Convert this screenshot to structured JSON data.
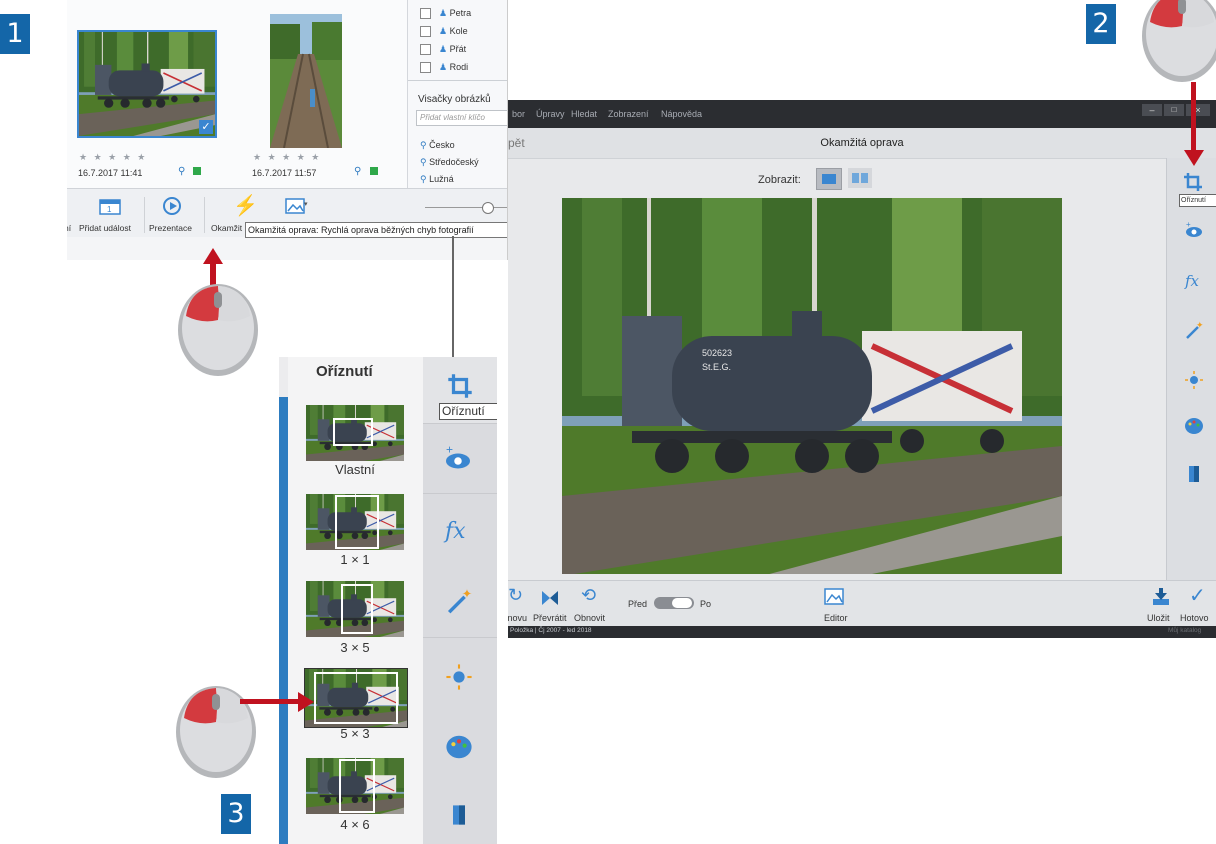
{
  "steps": {
    "one": "1",
    "two": "2",
    "three": "3"
  },
  "panel1": {
    "photos": [
      {
        "date": "16.7.2017 11:41",
        "stars": "★ ★ ★ ★ ★"
      },
      {
        "date": "16.7.2017 11:57",
        "stars": "★ ★ ★ ★ ★"
      }
    ],
    "people": [
      "Petra",
      "Kole",
      "Přát",
      "Rodi"
    ],
    "tags_header": "Visačky obrázků",
    "tags_placeholder": "Přidat vlastní klíčo",
    "places": [
      "Česko",
      "Středočeský",
      "Lužná"
    ],
    "toolbar": {
      "add_event": "Přidat událost",
      "add_event_prefix": "ní",
      "slideshow": "Prezentace",
      "quick_fix": "Okamžit"
    },
    "tooltip": "Okamžitá oprava: Rychlá oprava běžných chyb fotografií"
  },
  "panel2": {
    "menu": [
      "bor",
      "Úpravy",
      "Hledat",
      "Zobrazení",
      "Nápověda"
    ],
    "back": "pět",
    "title": "Okamžitá oprava",
    "view_label": "Zobrazit:",
    "crop_tooltip": "Oříznutí",
    "bottom": {
      "redo": "Znovu",
      "rotate": "Převrátit",
      "reset": "Obnovit",
      "before": "Před",
      "after": "Po",
      "editor": "Editor",
      "save": "Uložit",
      "done": "Hotovo"
    },
    "status_left": "Položka | Čj 2007 - led 2018",
    "status_right": "Můj katalog"
  },
  "panel3": {
    "title": "Oříznutí",
    "crop_tooltip": "Oříznutí",
    "presets": [
      "Vlastní",
      "1 × 1",
      "3 × 5",
      "5 × 3",
      "4 × 6"
    ]
  },
  "colors": {
    "accent_blue": "#1466a8",
    "arrow_red": "#c0121f",
    "menubar": "#2b2d31"
  }
}
